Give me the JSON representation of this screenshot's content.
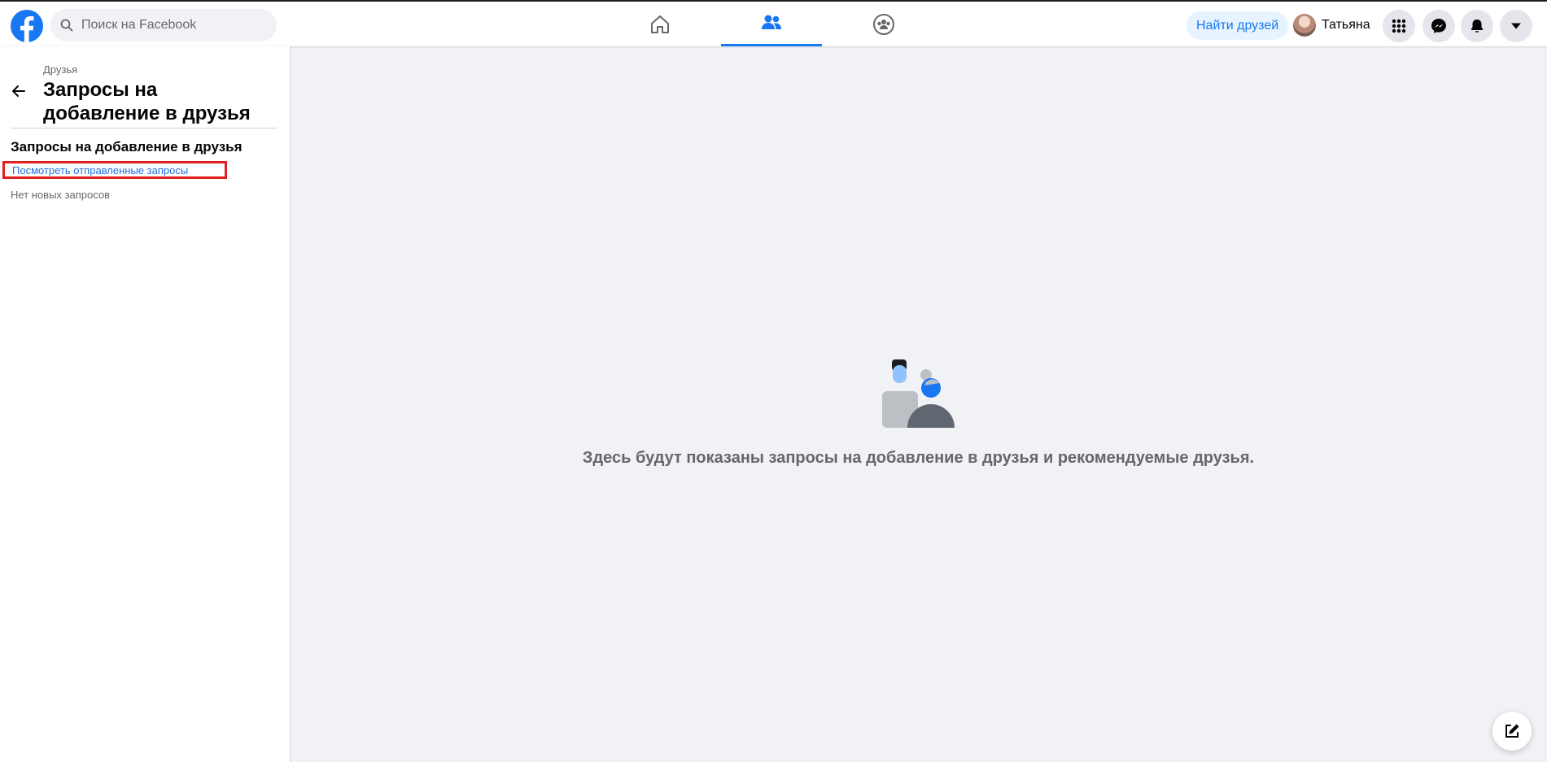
{
  "header": {
    "search_placeholder": "Поиск на Facebook",
    "find_friends_label": "Найти друзей",
    "profile_name": "Татьяна",
    "icons": [
      "facebook-logo",
      "search-icon",
      "home-icon",
      "friends-icon",
      "groups-icon",
      "menu-grid-icon",
      "messenger-icon",
      "notifications-icon",
      "account-caret-icon"
    ],
    "active_tab": "friends"
  },
  "sidebar": {
    "breadcrumb": "Друзья",
    "title": "Запросы на добавление в друзья",
    "section_title": "Запросы на добавление в друзья",
    "sent_requests_link": "Посмотреть отправленные запросы",
    "no_requests": "Нет новых запросов"
  },
  "main": {
    "empty_message": "Здесь будут показаны запросы на добавление в друзья и рекомендуемые друзья."
  },
  "colors": {
    "brand_blue": "#1877f2",
    "background": "#f0f2f5",
    "highlight_box": "#e02020"
  }
}
